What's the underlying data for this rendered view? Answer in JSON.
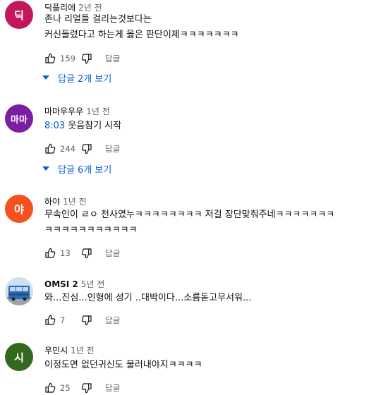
{
  "comments": [
    {
      "avatar_letter": "딕",
      "avatar_color": "#c2185b",
      "author": "딕플리에",
      "time": "2년 전",
      "lines": [
        "존나 리얼들 걸리는것보다는",
        "커신들렸다고 하는게 옳은 판단이제ㅋㅋㅋㅋㅋㅋㅋ"
      ],
      "likes": "159",
      "reply_label": "답글",
      "replies_label": "답글 2개 보기"
    },
    {
      "avatar_letter": "마마",
      "avatar_color": "#7b1fa2",
      "author": "마마우우우",
      "time": "1년 전",
      "timestamp_link": "8:03",
      "line_rest": " 웃음참기 시작",
      "likes": "244",
      "reply_label": "답글",
      "replies_label": "답글 6개 보기"
    },
    {
      "avatar_letter": "야",
      "avatar_color": "#f4511e",
      "author": "하야",
      "time": "1년 전",
      "lines": [
        "무속인이 ㄹㅇ 천사였누ㅋㅋㅋㅋㅋㅋㅋㅋ 저걸 장단맞춰주네ㅋㅋㅋㅋㅋㅋㅋ",
        "ㅋㅋㅋㅋㅋㅋㅋㅋㅋㅋㅋ"
      ],
      "likes": "13",
      "reply_label": "답글"
    },
    {
      "avatar_kind": "bus-photo",
      "author": "OMSI 2",
      "time": "5년 전",
      "lines": [
        "와...진심...인형에 성기 ..대박이다...소름돋고무서워..."
      ],
      "likes": "7",
      "reply_label": "답글"
    },
    {
      "avatar_letter": "시",
      "avatar_color": "#33691e",
      "author": "우민시",
      "time": "1년 전",
      "lines": [
        "이정도면 없던귀신도 불러내야지ㅋㅋㅋㅋ"
      ],
      "likes": "25",
      "reply_label": "답글"
    }
  ],
  "colors": {
    "link": "#065fd4",
    "secondary": "#606060",
    "text": "#0f0f0f"
  }
}
